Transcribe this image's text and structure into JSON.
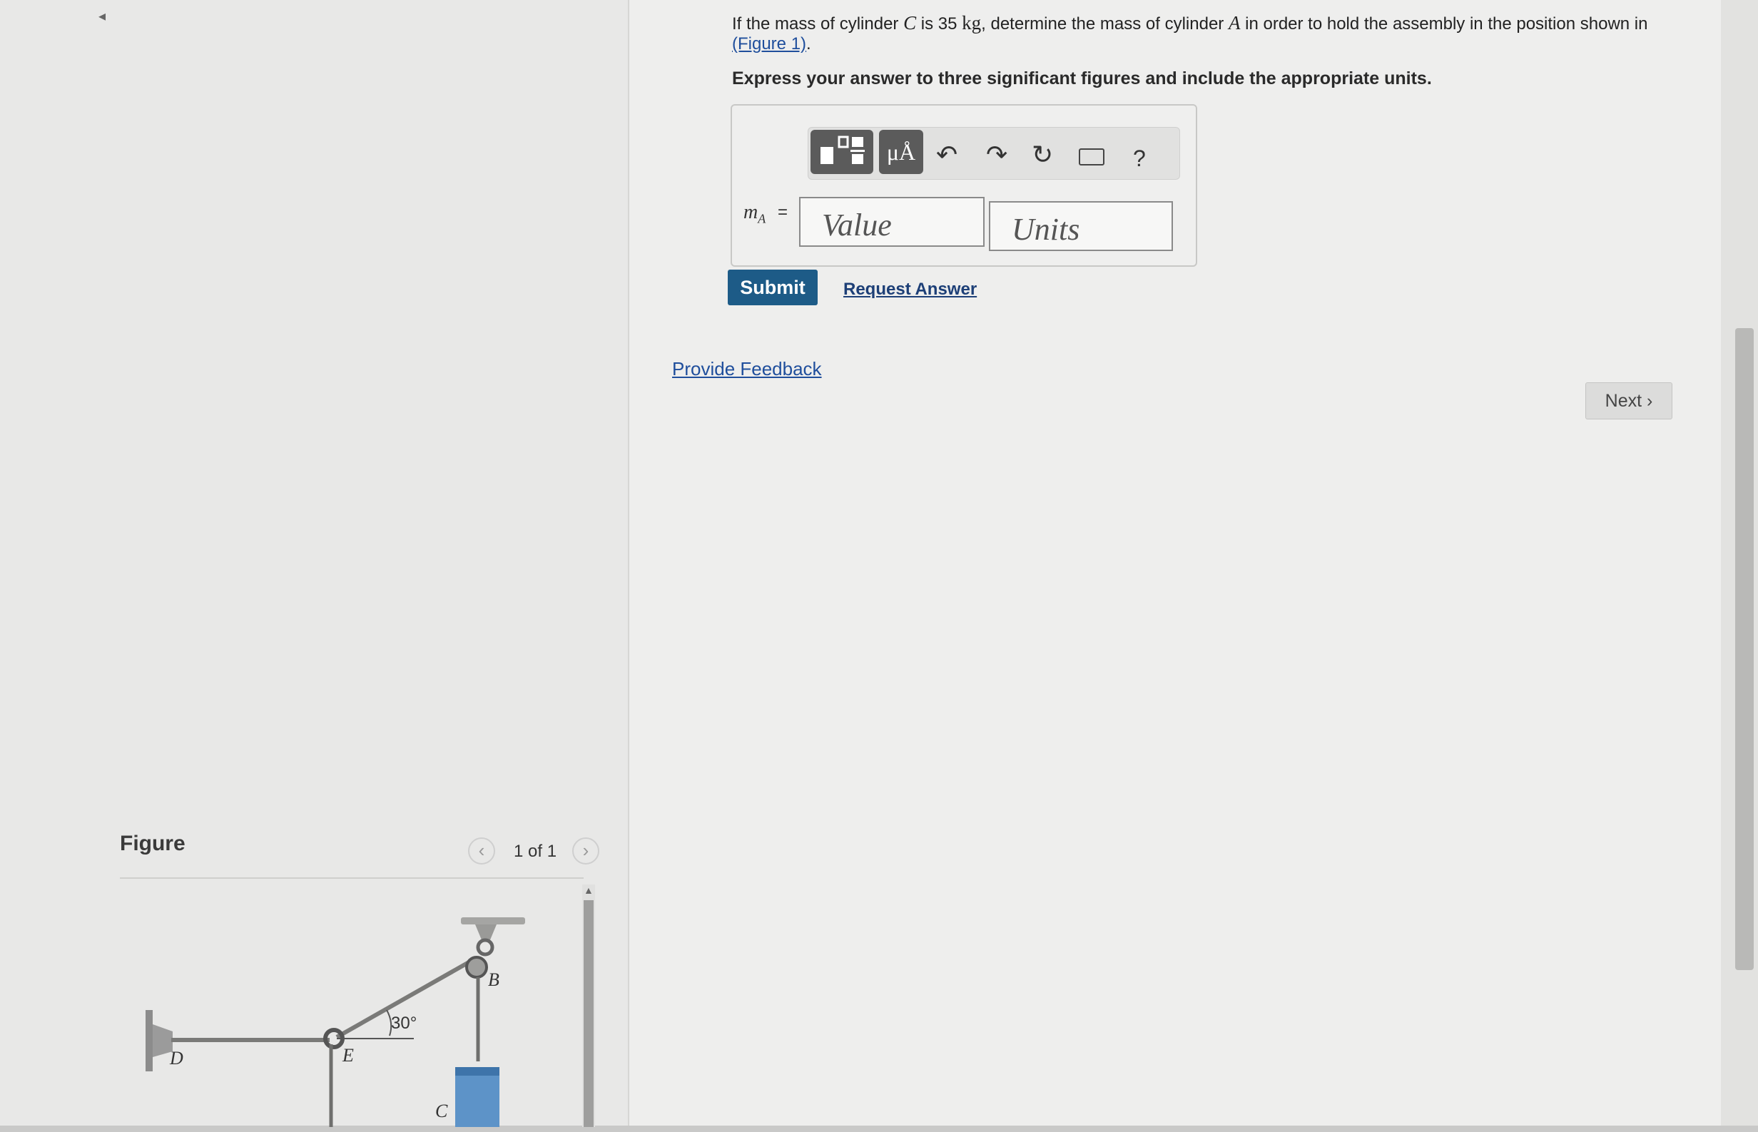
{
  "problem": {
    "q_part1": "If the mass of cylinder ",
    "cyl_c": "C",
    "q_part2": " is 35 ",
    "unit_kg": "kg",
    "q_part3": ", determine the mass of cylinder ",
    "cyl_a": "A",
    "q_part4": " in order to hold the assembly in the position shown in ",
    "figure_link": "(Figure 1)",
    "q_end": ".",
    "instructions": "Express your answer to three significant figures and include the appropriate units."
  },
  "answer": {
    "variable": "m",
    "variable_sub": "A",
    "equals": "=",
    "value_placeholder": "Value",
    "units_placeholder": "Units"
  },
  "toolbar": {
    "units_label": "μÅ",
    "help_label": "?"
  },
  "actions": {
    "submit": "Submit",
    "request_answer": "Request Answer",
    "provide_feedback": "Provide Feedback",
    "next": "Next"
  },
  "figure": {
    "title": "Figure",
    "count": "1 of 1",
    "labels": {
      "d": "D",
      "e": "E",
      "b": "B",
      "c": "C",
      "angle": "30°"
    }
  }
}
